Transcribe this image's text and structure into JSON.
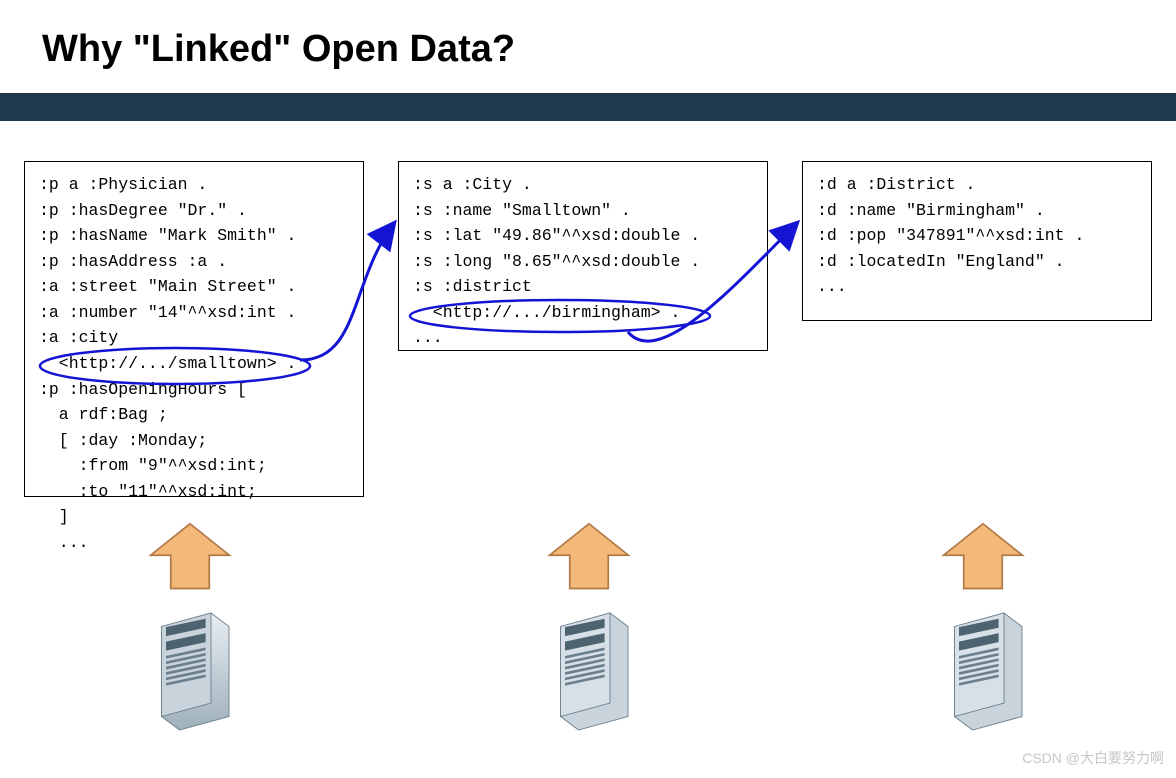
{
  "title": "Why \"Linked\" Open Data?",
  "colors": {
    "bar": "#1f3a4d",
    "arrow_fill": "#f4b879",
    "arrow_stroke": "#b07a46",
    "link_stroke": "#1414d4"
  },
  "panels": {
    "left": {
      "lines": [
        ":p a :Physician .",
        ":p :hasDegree \"Dr.\" .",
        ":p :hasName \"Mark Smith\" .",
        ":p :hasAddress :a .",
        ":a :street \"Main Street\" .",
        ":a :number \"14\"^^xsd:int .",
        ":a :city",
        "  <http://.../smalltown> .",
        ":p :hasOpeningHours [",
        "  a rdf:Bag ;",
        "  [ :day :Monday;",
        "    :from \"9\"^^xsd:int;",
        "    :to \"11\"^^xsd:int;",
        "  ]",
        "  ..."
      ]
    },
    "mid": {
      "lines": [
        ":s a :City .",
        ":s :name \"Smalltown\" .",
        ":s :lat \"49.86\"^^xsd:double .",
        ":s :long \"8.65\"^^xsd:double .",
        ":s :district",
        "  <http://.../birmingham> .",
        "..."
      ]
    },
    "right": {
      "lines": [
        ":d a :District .",
        ":d :name \"Birmingham\" .",
        ":d :pop \"347891\"^^xsd:int .",
        ":d :locatedIn \"England\" .",
        "..."
      ]
    }
  },
  "link_arrows": [
    {
      "from_label": "smalltown-uri",
      "to_label": "city-panel"
    },
    {
      "from_label": "birmingham-uri",
      "to_label": "district-panel"
    }
  ],
  "servers": 3,
  "watermark": "CSDN @大白要努力啊"
}
